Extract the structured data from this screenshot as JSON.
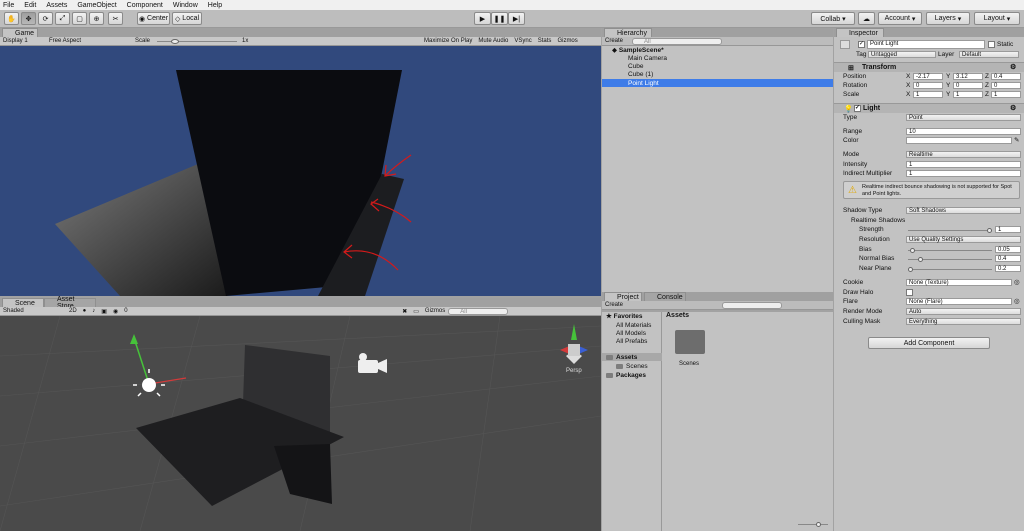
{
  "menu": [
    "File",
    "Edit",
    "Assets",
    "GameObject",
    "Component",
    "Window",
    "Help"
  ],
  "toolbar": {
    "center": "Center",
    "local": "Local",
    "collab": "Collab ▾",
    "account": "Account",
    "layers": "Layers",
    "layout": "Layout"
  },
  "game": {
    "tab": "Game",
    "display": "Display 1",
    "aspect": "Free Aspect",
    "scale_label": "Scale",
    "scale_value": "1x",
    "opts": [
      "Maximize On Play",
      "Mute Audio",
      "VSync",
      "Stats",
      "Gizmos"
    ]
  },
  "scene": {
    "tabs": [
      "Scene",
      "Asset Store"
    ],
    "shading": "Shaded",
    "mode2d": "2D",
    "fx_count": "0",
    "gizmos": "Gizmos",
    "search_placeholder": "All",
    "persp": "Persp"
  },
  "hierarchy": {
    "tab": "Hierarchy",
    "create": "Create",
    "search_placeholder": "All",
    "scene": "SampleScene*",
    "items": [
      "Main Camera",
      "Cube",
      "Cube (1)",
      "Point Light"
    ]
  },
  "project": {
    "tabs": [
      "Project",
      "Console"
    ],
    "create": "Create",
    "favorites": "Favorites",
    "fav_items": [
      "All Materials",
      "All Models",
      "All Prefabs"
    ],
    "assets": "Assets",
    "assets_child": "Scenes",
    "packages": "Packages",
    "breadcrumb": "Assets",
    "folder": "Scenes"
  },
  "inspector": {
    "tab": "Inspector",
    "name": "Point Light",
    "static": "Static",
    "tag_label": "Tag",
    "tag": "Untagged",
    "layer_label": "Layer",
    "layer": "Default",
    "transform": "Transform",
    "position": {
      "label": "Position",
      "x": "-2.17",
      "y": "3.12",
      "z": "0.4"
    },
    "rotation": {
      "label": "Rotation",
      "x": "0",
      "y": "0",
      "z": "0"
    },
    "scale": {
      "label": "Scale",
      "x": "1",
      "y": "1",
      "z": "1"
    },
    "light": "Light",
    "type": {
      "label": "Type",
      "value": "Point"
    },
    "range": {
      "label": "Range",
      "value": "10"
    },
    "color_label": "Color",
    "mode": {
      "label": "Mode",
      "value": "Realtime"
    },
    "intensity": {
      "label": "Intensity",
      "value": "1"
    },
    "indirect": {
      "label": "Indirect Multiplier",
      "value": "1"
    },
    "warning": "Realtime indirect bounce shadowing is not supported for Spot and Point lights.",
    "shadow_type": {
      "label": "Shadow Type",
      "value": "Soft Shadows"
    },
    "realtime_shadows": "Realtime Shadows",
    "strength": {
      "label": "Strength",
      "value": "1",
      "level": 1.0
    },
    "resolution": {
      "label": "Resolution",
      "value": "Use Quality Settings"
    },
    "bias": {
      "label": "Bias",
      "value": "0.05",
      "level": 0.025
    },
    "normal_bias": {
      "label": "Normal Bias",
      "value": "0.4",
      "level": 0.13
    },
    "near_plane": {
      "label": "Near Plane",
      "value": "0.2",
      "level": 0.0
    },
    "cookie": {
      "label": "Cookie",
      "value": "None (Texture)"
    },
    "draw_halo": "Draw Halo",
    "flare": {
      "label": "Flare",
      "value": "None (Flare)"
    },
    "render_mode": {
      "label": "Render Mode",
      "value": "Auto"
    },
    "culling": {
      "label": "Culling Mask",
      "value": "Everything"
    },
    "add_component": "Add Component"
  },
  "colors": {
    "game_bg": "#31497d",
    "selection": "#3e7ce8",
    "panel": "#c2c2c2"
  }
}
